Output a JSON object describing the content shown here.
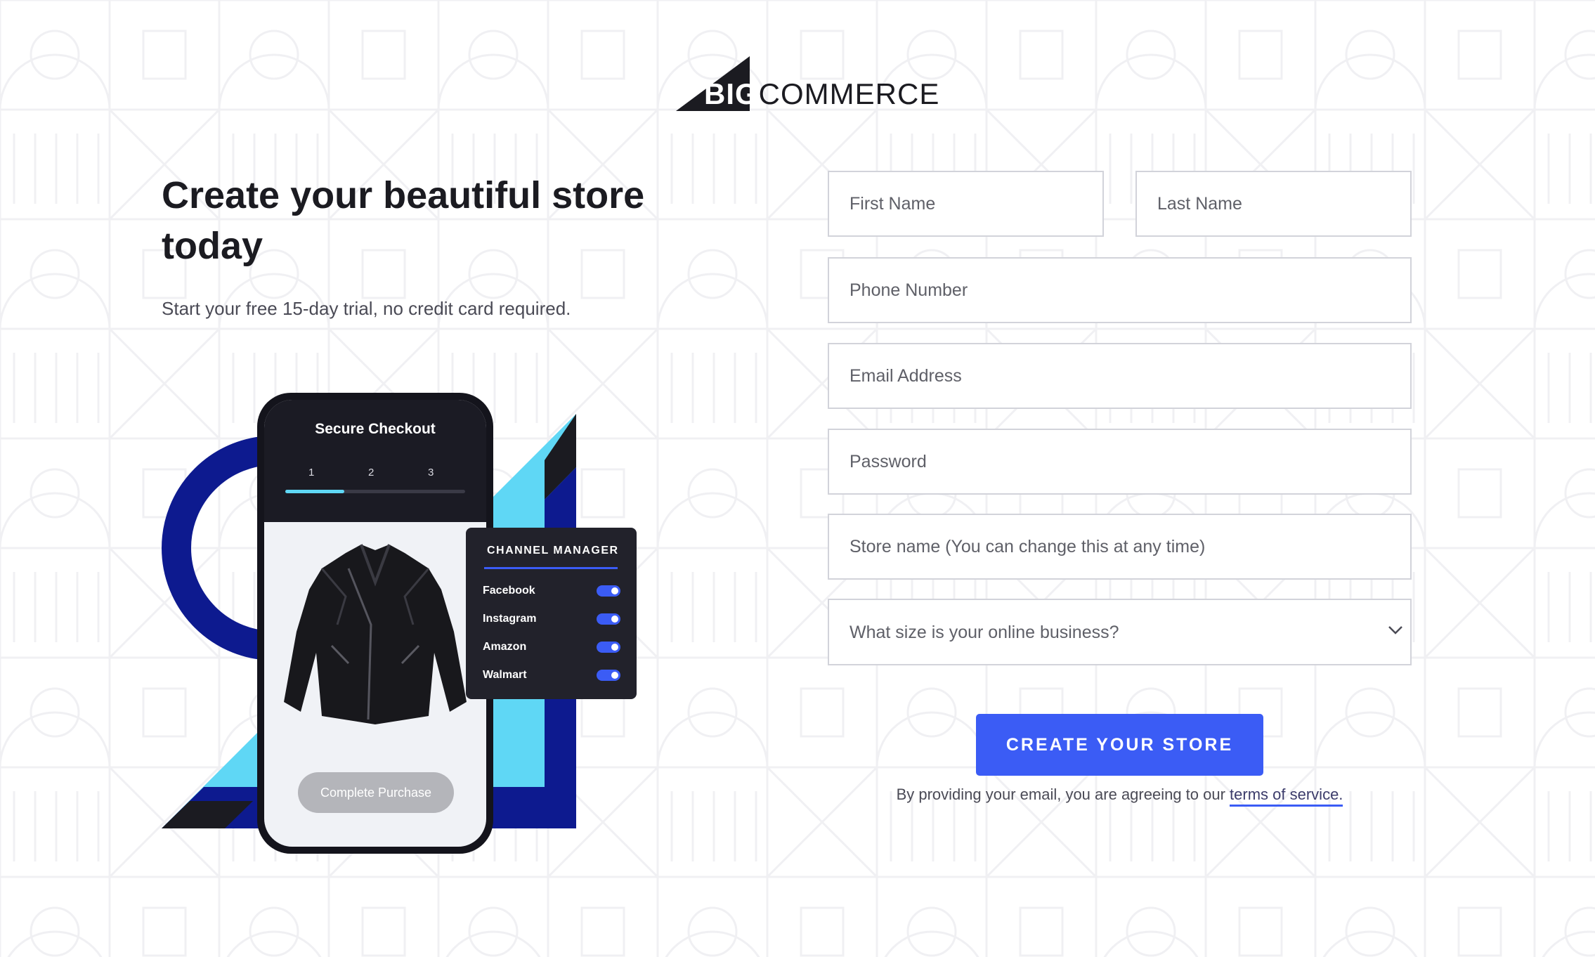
{
  "brand": {
    "logo_text_big": "BIG",
    "logo_text_commerce": "COMMERCE",
    "accent_color": "#3b5cf5",
    "navy_color": "#0d1a8f",
    "cyan_color": "#5fd7f5"
  },
  "hero": {
    "headline": "Create your beautiful store today",
    "subline": "Start your free 15-day trial, no credit card required."
  },
  "illustration": {
    "checkout_title": "Secure Checkout",
    "steps": [
      "1",
      "2",
      "3"
    ],
    "progress_fraction": 0.33,
    "complete_button": "Complete Purchase",
    "product_icon": "leather-jacket-icon",
    "channel_manager": {
      "title": "CHANNEL MANAGER",
      "channels": [
        {
          "name": "Facebook",
          "enabled": true
        },
        {
          "name": "Instagram",
          "enabled": true
        },
        {
          "name": "Amazon",
          "enabled": true
        },
        {
          "name": "Walmart",
          "enabled": true
        }
      ]
    }
  },
  "form": {
    "first_name": {
      "placeholder": "First Name",
      "value": ""
    },
    "last_name": {
      "placeholder": "Last Name",
      "value": ""
    },
    "phone": {
      "placeholder": "Phone Number",
      "value": ""
    },
    "email": {
      "placeholder": "Email Address",
      "value": ""
    },
    "password": {
      "placeholder": "Password",
      "value": ""
    },
    "store_name": {
      "placeholder": "Store name (You can change this at any time)",
      "value": ""
    },
    "business_size": {
      "placeholder": "What size is your online business?",
      "chevron_icon": "chevron-down-icon"
    },
    "submit_label": "CREATE YOUR STORE",
    "terms_prefix": "By providing your email, you are agreeing to our ",
    "terms_link": "terms of service."
  }
}
